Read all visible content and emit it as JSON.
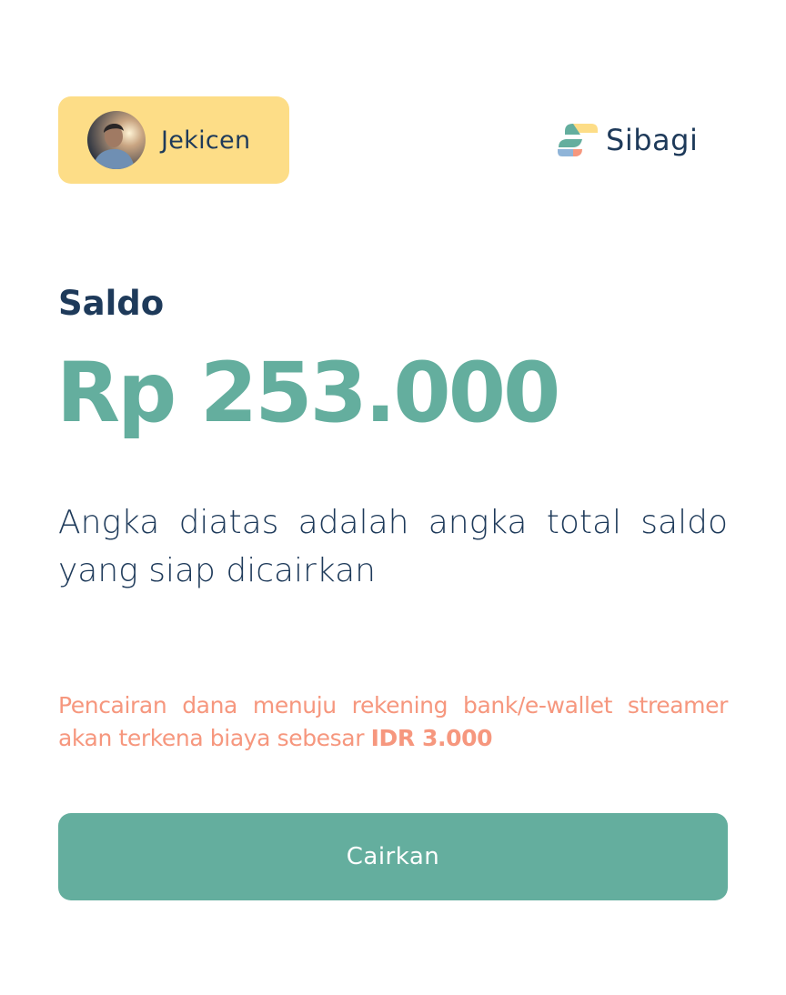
{
  "user": {
    "name": "Jekicen",
    "avatar_icon": "user-avatar-photo"
  },
  "brand": {
    "name": "Sibagi",
    "logo_icon": "sibagi-logo-icon",
    "logo_colors": [
      "#64ae9e",
      "#fddd87",
      "#f6977e",
      "#8fb4d8"
    ]
  },
  "balance": {
    "label": "Saldo",
    "amount": "Rp 253.000",
    "description": "Angka diatas adalah angka total saldo yang siap dicairkan"
  },
  "fee_note": {
    "text": "Pencairan dana menuju rekening bank/e-wallet streamer akan terkena biaya sebesar ",
    "amount": "IDR 3.000"
  },
  "actions": {
    "withdraw_label": "Cairkan"
  },
  "colors": {
    "primary": "#64ae9e",
    "chip_background": "#fddd87",
    "text_dark": "#1e3a5a",
    "fee_text": "#f6977e",
    "background": "#ffffff"
  }
}
